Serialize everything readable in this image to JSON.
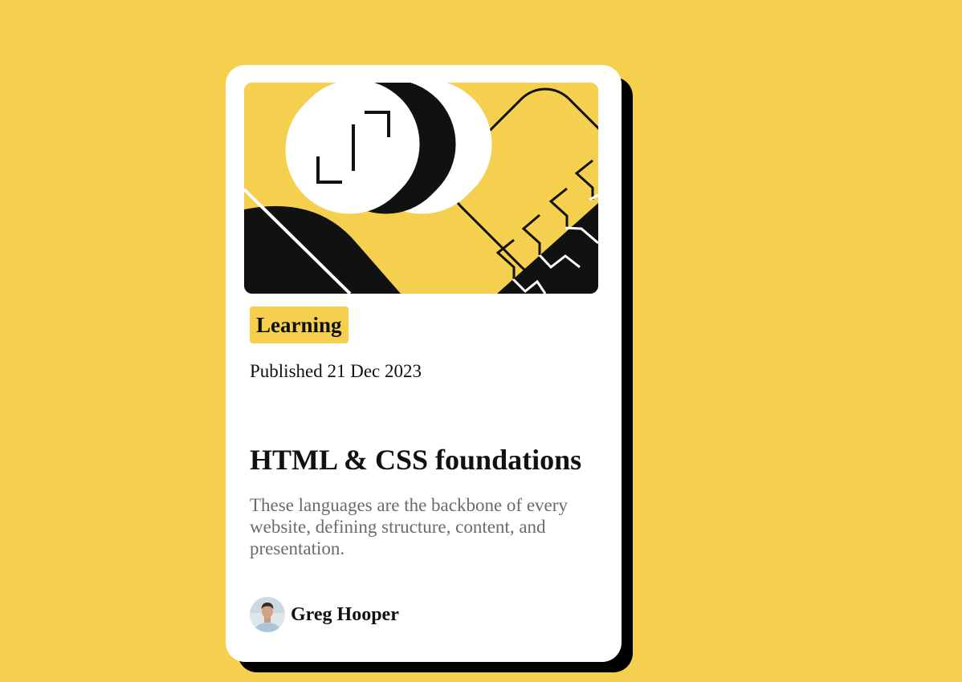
{
  "card": {
    "tag": "Learning",
    "published": "Published 21 Dec 2023",
    "title": "HTML & CSS foundations",
    "description": "These languages are the backbone of every website, defining structure, content, and presentation.",
    "author": {
      "name": "Greg Hooper"
    }
  },
  "colors": {
    "background": "#f4d04e",
    "card": "#ffffff",
    "shadow": "#000000",
    "text": "#111111",
    "muted": "#6b6b6b"
  },
  "icons": {
    "hero": "illustration-article",
    "avatar": "avatar-greg-hooper"
  }
}
